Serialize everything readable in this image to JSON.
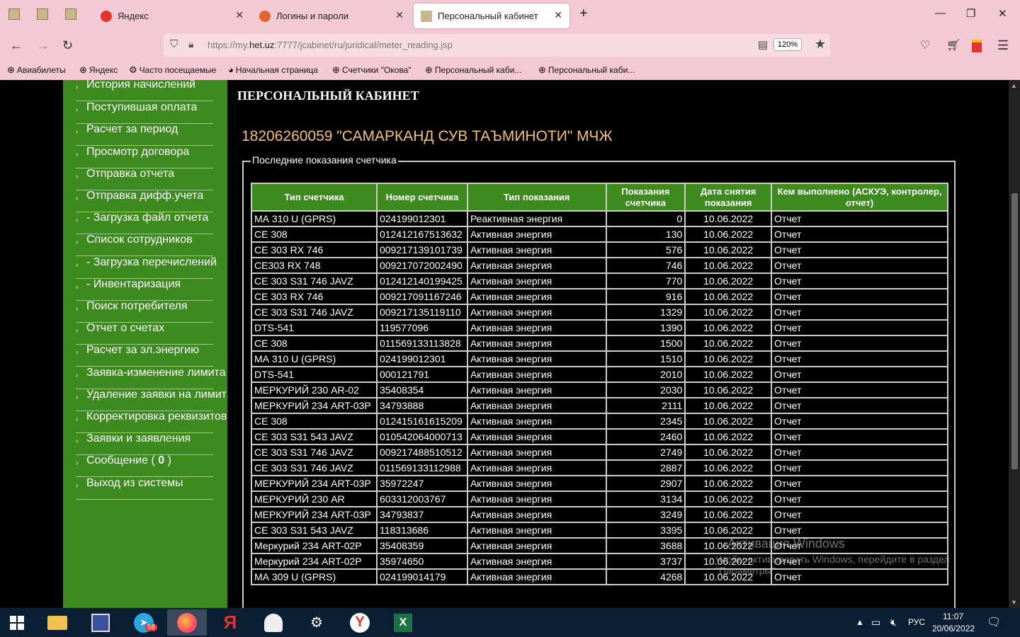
{
  "browser": {
    "tabs": [
      {
        "label": "Яндекс"
      },
      {
        "label": "Логины и пароли"
      },
      {
        "label": "Персональный кабинет"
      }
    ],
    "url_prefix": "https://my.",
    "url_domain": "het.uz",
    "url_suffix": ":7777/jcabinet/ru/juridical/meter_reading.jsp",
    "zoom": "120%",
    "new_tab": "+",
    "bookmarks": [
      {
        "label": "Авиабилеты"
      },
      {
        "label": "Яндекс"
      },
      {
        "label": "Часто посещаемые"
      },
      {
        "label": "Начальная страница"
      },
      {
        "label": "Счетчики \"Окова\""
      },
      {
        "label": "Персональный каби..."
      },
      {
        "label": "Персональный каби..."
      }
    ]
  },
  "sidebar": {
    "items": [
      {
        "label": "История начислений"
      },
      {
        "label": "Поступившая оплата"
      },
      {
        "label": "Расчет за период"
      },
      {
        "label": "Просмотр договора"
      },
      {
        "label": "Отправка отчета"
      },
      {
        "label": "Отправка дифф.учета"
      },
      {
        "label": "- Загрузка файл отчета"
      },
      {
        "label": "Список сотрудников"
      },
      {
        "label": "- Загрузка перечислений"
      },
      {
        "label": "- Инвентаризация"
      },
      {
        "label": "Поиск потребителя"
      },
      {
        "label": "Отчет о счетах"
      },
      {
        "label": "Расчет за эл.энергию"
      },
      {
        "label": "Заявка-изменение лимита"
      },
      {
        "label": "Удаление заявки на лимит"
      },
      {
        "label": "Корректировка реквизитов"
      },
      {
        "label": "Заявки и заявления"
      },
      {
        "label": "Сообщение ( 0 )"
      },
      {
        "label": "Выход из системы"
      }
    ]
  },
  "page": {
    "title": "ПЕРСОНАЛЬНЫЙ КАБИНЕТ",
    "org": "18206260059 \"САМАРКАНД СУВ ТАЪМИНОТИ\" МЧЖ",
    "section_legend": "Последние показания счетчика"
  },
  "table": {
    "headers": [
      "Тип счетчика",
      "Номер счетчика",
      "Тип показания",
      "Показания счетчика",
      "Дата снятия показания",
      "Кем выполнено (АСКУЭ, контролер, отчет)"
    ],
    "rows": [
      [
        "МА 310 U (GPRS)",
        "024199012301",
        "Реактивная энергия",
        "0",
        "10.06.2022",
        "Отчет"
      ],
      [
        "CE 308",
        "012412167513632",
        "Активная энергия",
        "130",
        "10.06.2022",
        "Отчет"
      ],
      [
        "CE 303 RX 746",
        "009217139101739",
        "Активная энергия",
        "576",
        "10.06.2022",
        "Отчет"
      ],
      [
        "CE303 RX 748",
        "009217072002490",
        "Активная энергия",
        "746",
        "10.06.2022",
        "Отчет"
      ],
      [
        "CE 303 S31 746 JAVZ",
        "012412140199425",
        "Активная энергия",
        "770",
        "10.06.2022",
        "Отчет"
      ],
      [
        "CE 303 RX 746",
        "009217091167246",
        "Активная энергия",
        "916",
        "10.06.2022",
        "Отчет"
      ],
      [
        "CE 303 S31 746 JAVZ",
        "009217135119110",
        "Активная энергия",
        "1329",
        "10.06.2022",
        "Отчет"
      ],
      [
        "DTS-541",
        "119577096",
        "Активная энергия",
        "1390",
        "10.06.2022",
        "Отчет"
      ],
      [
        "CE 308",
        "011569133113828",
        "Активная энергия",
        "1500",
        "10.06.2022",
        "Отчет"
      ],
      [
        "МА 310 U (GPRS)",
        "024199012301",
        "Активная энергия",
        "1510",
        "10.06.2022",
        "Отчет"
      ],
      [
        "DTS-541",
        "000121791",
        "Активная энергия",
        "2010",
        "10.06.2022",
        "Отчет"
      ],
      [
        "МЕРКУРИЙ 230 AR-02",
        "35408354",
        "Активная энергия",
        "2030",
        "10.06.2022",
        "Отчет"
      ],
      [
        "МЕРКУРИЙ 234 ART-03P",
        "34793888",
        "Активная энергия",
        "2111",
        "10.06.2022",
        "Отчет"
      ],
      [
        "CE 308",
        "012415161615209",
        "Активная энергия",
        "2345",
        "10.06.2022",
        "Отчет"
      ],
      [
        "CE 303 S31 543 JAVZ",
        "010542064000713",
        "Активная энергия",
        "2460",
        "10.06.2022",
        "Отчет"
      ],
      [
        "CE 303 S31 746 JAVZ",
        "009217488510512",
        "Активная энергия",
        "2749",
        "10.06.2022",
        "Отчет"
      ],
      [
        "CE 303 S31 746 JAVZ",
        "011569133112988",
        "Активная энергия",
        "2887",
        "10.06.2022",
        "Отчет"
      ],
      [
        "МЕРКУРИЙ 234 ART-03P",
        "35972247",
        "Активная энергия",
        "2907",
        "10.06.2022",
        "Отчет"
      ],
      [
        "МЕРКУРИЙ 230 AR",
        "603312003767",
        "Активная энергия",
        "3134",
        "10.06.2022",
        "Отчет"
      ],
      [
        "МЕРКУРИЙ 234 ART-03P",
        "34793837",
        "Активная энергия",
        "3249",
        "10.06.2022",
        "Отчет"
      ],
      [
        "CE 303 S31 543 JAVZ",
        "118313686",
        "Активная энергия",
        "3395",
        "10.06.2022",
        "Отчет"
      ],
      [
        "Меркурий 234 ART-02P",
        "35408359",
        "Активная энергия",
        "3688",
        "10.06.2022",
        "Отчет"
      ],
      [
        "Меркурий 234 ART-02P",
        "35974650",
        "Активная энергия",
        "3737",
        "10.06.2022",
        "Отчет"
      ],
      [
        "МА 309 U (GPRS)",
        "024199014179",
        "Активная энергия",
        "4268",
        "10.06.2022",
        "Отчет"
      ]
    ]
  },
  "watermark": {
    "line1": "Активация Windows",
    "line2": "Чтобы активировать Windows, перейдите в раздел \"Параметры\"."
  },
  "taskbar": {
    "telegram_badge": "58",
    "lang": "РУС",
    "time": "11:07",
    "date": "20/06/2022"
  },
  "colors": {
    "sidebar_green": "#3d8a1f",
    "header_green": "#3d8a1f",
    "org_title": "#f5c06b",
    "browser_chrome": "#f3c9d3"
  }
}
